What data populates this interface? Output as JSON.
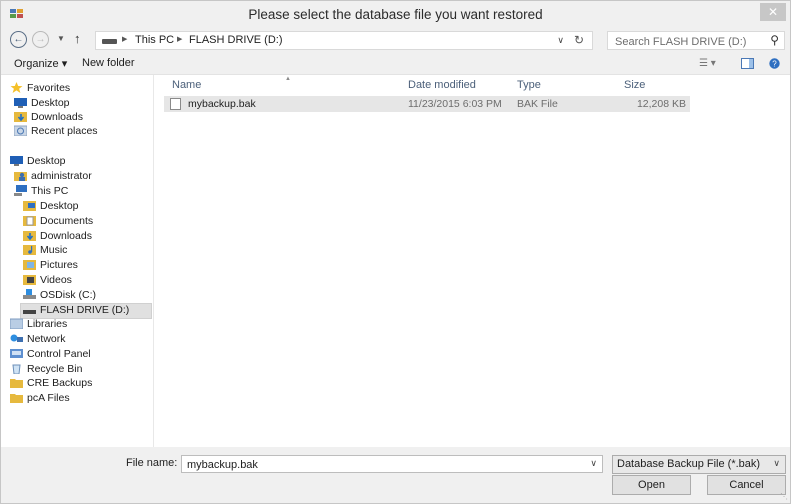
{
  "window": {
    "title": "Please select the database file you want restored",
    "close_glyph": "✕"
  },
  "nav": {
    "back_icon": "back-arrow-icon",
    "forward_icon": "forward-arrow-icon",
    "recent_icon": "chevron-down-icon",
    "up_icon": "up-arrow-icon",
    "address": {
      "crumbs": [
        "This PC",
        "FLASH DRIVE (D:)"
      ],
      "dropdown_icon": "chevron-down-icon",
      "refresh_icon": "refresh-icon"
    },
    "search": {
      "placeholder": "Search FLASH DRIVE (D:)",
      "icon": "search-icon"
    }
  },
  "toolbar": {
    "organize_label": "Organize ▾",
    "new_folder_label": "New folder",
    "icons": [
      "view-options-icon",
      "preview-pane-icon",
      "help-icon"
    ]
  },
  "sidebar": {
    "items": [
      {
        "label": "Favorites",
        "icon": "star-icon"
      },
      {
        "label": "Desktop",
        "icon": "desktop-icon"
      },
      {
        "label": "Downloads",
        "icon": "downloads-icon"
      },
      {
        "label": "Recent places",
        "icon": "recent-places-icon"
      },
      {
        "label": "Desktop",
        "icon": "desktop-icon"
      },
      {
        "label": "administrator",
        "icon": "user-folder-icon"
      },
      {
        "label": "This PC",
        "icon": "computer-icon"
      },
      {
        "label": "Desktop",
        "icon": "desktop-folder-icon"
      },
      {
        "label": "Documents",
        "icon": "documents-icon"
      },
      {
        "label": "Downloads",
        "icon": "downloads-icon"
      },
      {
        "label": "Music",
        "icon": "music-icon"
      },
      {
        "label": "Pictures",
        "icon": "pictures-icon"
      },
      {
        "label": "Videos",
        "icon": "videos-icon"
      },
      {
        "label": "OSDisk (C:)",
        "icon": "system-drive-icon"
      },
      {
        "label": "FLASH DRIVE (D:)",
        "icon": "usb-drive-icon",
        "selected": true
      },
      {
        "label": "Libraries",
        "icon": "libraries-icon"
      },
      {
        "label": "Network",
        "icon": "network-icon"
      },
      {
        "label": "Control Panel",
        "icon": "control-panel-icon"
      },
      {
        "label": "Recycle Bin",
        "icon": "recycle-bin-icon"
      },
      {
        "label": "CRE Backups",
        "icon": "folder-icon"
      },
      {
        "label": "pcA Files",
        "icon": "folder-icon"
      }
    ]
  },
  "file_list": {
    "columns": [
      "Name",
      "Date modified",
      "Type",
      "Size"
    ],
    "rows": [
      {
        "name": "mybackup.bak",
        "date_modified": "11/23/2015 6:03 PM",
        "type": "BAK File",
        "size": "12,208 KB"
      }
    ]
  },
  "footer": {
    "file_name_label": "File name:",
    "file_name_value": "mybackup.bak",
    "file_type_value": "Database Backup File (*.bak)",
    "open_label": "Open",
    "cancel_label": "Cancel"
  },
  "colors": {
    "header_text": "#4c607a",
    "selection": "#e6e6e6",
    "folder": "#e6b93e"
  }
}
